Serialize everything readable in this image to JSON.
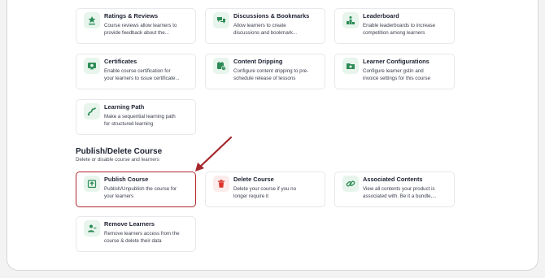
{
  "colors": {
    "accent": "#2e8b57",
    "icon_bg": "#e7f5ec",
    "danger": "#d9342b",
    "highlight_border": "#b4262c",
    "arrow": "#a5272b"
  },
  "section": {
    "title": "Publish/Delete Course",
    "subtitle": "Delete or disable course and learners"
  },
  "cards": {
    "ratings": {
      "title": "Ratings & Reviews",
      "desc": "Course reviews allow learners to\nprovide feedback about the...",
      "icon": "badge-star-icon"
    },
    "discussions": {
      "title": "Discussions & Bookmarks",
      "desc": "Allow learners to create\ndiscussions and bookmark...",
      "icon": "chat-bubbles-icon"
    },
    "leaderboard": {
      "title": "Leaderboard",
      "desc": "Enable leaderboards to increase\ncompetition among learners",
      "icon": "leaderboard-icon"
    },
    "certificates": {
      "title": "Certificates",
      "desc": "Enable course certification for\nyour learners to issue certificate...",
      "icon": "certificate-icon"
    },
    "dripping": {
      "title": "Content Dripping",
      "desc": "Configure content dripping to pre-\nschedule release of lessons",
      "icon": "calendar-clock-icon"
    },
    "learner_config": {
      "title": "Learner Configurations",
      "desc": "Configure learner gstin and\ninvoice settings for this course",
      "icon": "folder-settings-icon"
    },
    "learning_path": {
      "title": "Learning Path",
      "desc": "Make a sequential learning path\nfor structured learning",
      "icon": "path-icon"
    },
    "publish": {
      "title": "Publish Course",
      "desc": "Publish/Unpublish the course for\nyour learners",
      "icon": "upload-icon"
    },
    "delete": {
      "title": "Delete Course",
      "desc": "Delete your course if you no\nlonger require it",
      "icon": "trash-icon"
    },
    "associated": {
      "title": "Associated Contents",
      "desc": "View all contents your product is\nassociated with. Be it a bundle,...",
      "icon": "link-icon"
    },
    "remove_learners": {
      "title": "Remove Learners",
      "desc": "Remove learners access from the\ncourse & delete their data",
      "icon": "user-remove-icon"
    }
  }
}
